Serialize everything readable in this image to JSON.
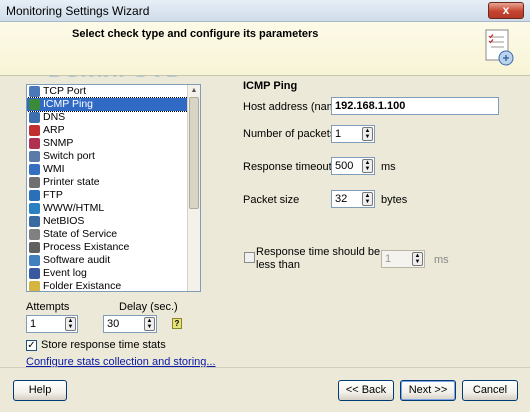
{
  "window": {
    "title": "Monitoring Settings Wizard",
    "close_symbol": "x"
  },
  "header": {
    "text": "Select check type and configure its parameters"
  },
  "watermark": "DOWNLOAD.com.vn",
  "check_types": {
    "items": [
      {
        "label": "TCP Port",
        "icon": "network-port-icon",
        "color": "#4a78b8"
      },
      {
        "label": "ICMP Ping",
        "icon": "ping-icon",
        "color": "#3a8a3a",
        "selected": true
      },
      {
        "label": "DNS",
        "icon": "dns-icon",
        "color": "#3d6fb0"
      },
      {
        "label": "ARP",
        "icon": "arp-icon",
        "color": "#c03030"
      },
      {
        "label": "SNMP",
        "icon": "snmp-icon",
        "color": "#b03050"
      },
      {
        "label": "Switch port",
        "icon": "switch-icon",
        "color": "#5a7aa8"
      },
      {
        "label": "WMI",
        "icon": "wmi-icon",
        "color": "#3570c0"
      },
      {
        "label": "Printer state",
        "icon": "printer-icon",
        "color": "#707070"
      },
      {
        "label": "FTP",
        "icon": "ftp-icon",
        "color": "#2a70b8"
      },
      {
        "label": "WWW/HTML",
        "icon": "globe-icon",
        "color": "#2a80c0"
      },
      {
        "label": "NetBIOS",
        "icon": "netbios-icon",
        "color": "#3a6aa0"
      },
      {
        "label": "State of Service",
        "icon": "service-icon",
        "color": "#808080"
      },
      {
        "label": "Process Existance",
        "icon": "process-icon",
        "color": "#606060"
      },
      {
        "label": "Software audit",
        "icon": "software-icon",
        "color": "#4080c0"
      },
      {
        "label": "Event log",
        "icon": "event-log-icon",
        "color": "#3a5aa0"
      },
      {
        "label": "Folder Existance",
        "icon": "folder-icon",
        "color": "#d6b440"
      }
    ]
  },
  "attempts": {
    "label": "Attempts",
    "value": "1"
  },
  "delay": {
    "label": "Delay (sec.)",
    "value": "30"
  },
  "store_stats": {
    "label": "Store response time stats",
    "checked": true
  },
  "configure_link": "Configure stats collection and storing...",
  "params": {
    "section_title": "ICMP Ping",
    "host_label": "Host address (name)",
    "host_value": "192.168.1.100",
    "packets_label": "Number of packets",
    "packets_value": "1",
    "timeout_label": "Response timeout",
    "timeout_value": "500",
    "timeout_unit": "ms",
    "size_label": "Packet size",
    "size_value": "32",
    "size_unit": "bytes",
    "rt_limit_label_1": "Response time should be",
    "rt_limit_label_2": "less than",
    "rt_limit_value": "1",
    "rt_limit_unit": "ms"
  },
  "footer": {
    "help": "Help",
    "back": "<< Back",
    "next": "Next >>",
    "cancel": "Cancel"
  }
}
